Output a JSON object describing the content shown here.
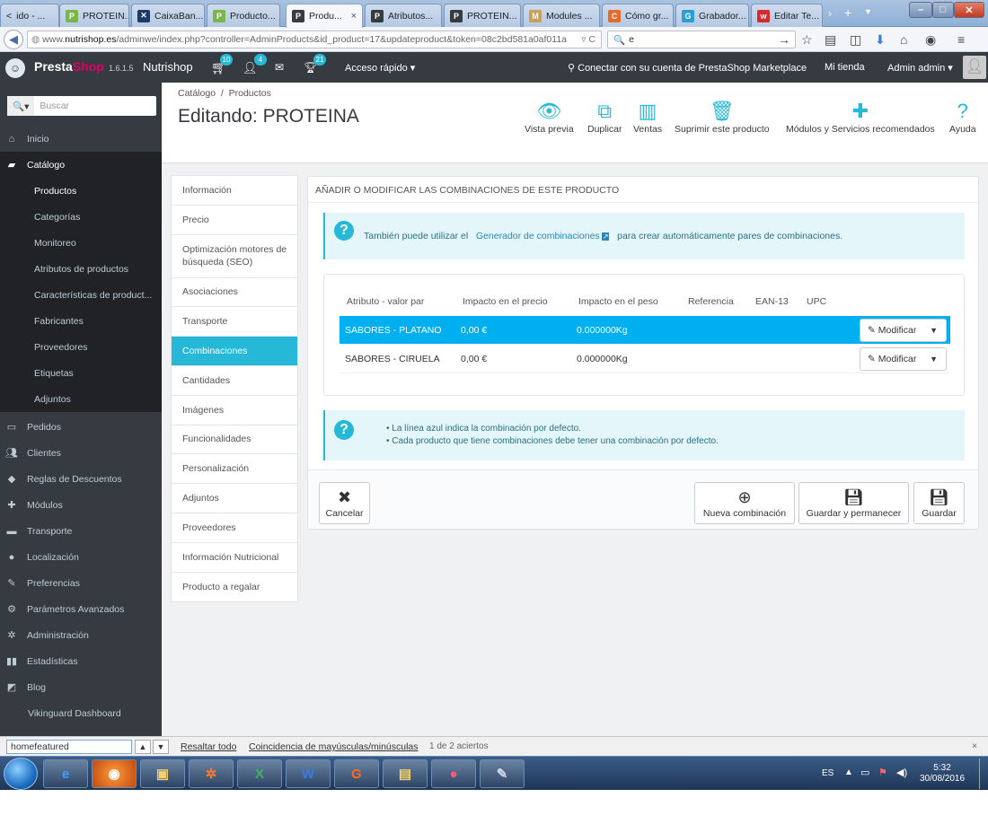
{
  "browser": {
    "tabs": [
      {
        "label": "ido - ..."
      },
      {
        "label": "PROTEIN..."
      },
      {
        "label": "CaixaBan..."
      },
      {
        "label": "Producto..."
      },
      {
        "label": "Produ..."
      },
      {
        "label": "Atributos..."
      },
      {
        "label": "PROTEIN..."
      },
      {
        "label": "Modules ..."
      },
      {
        "label": "Cómo gr..."
      },
      {
        "label": "Grabador..."
      },
      {
        "label": "Editar Te..."
      }
    ],
    "url_prefix": "www.",
    "url_domain": "nutrishop.es",
    "url_path": "/adminwe/index.php?controller=AdminProducts&id_product=17&updateproduct&token=08c2bd581a0af011a",
    "search_value": "e"
  },
  "header": {
    "brand_a": "Presta",
    "brand_b": "Shop",
    "version": "1.6.1.5",
    "shop_name": "Nutrishop",
    "badges": [
      "10",
      "4",
      "21"
    ],
    "quick_access": "Acceso rápido",
    "marketplace": "Conectar con su cuenta de PrestaShop Marketplace",
    "my_shop": "Mi tienda",
    "user": "Admin admin"
  },
  "sidebar": {
    "search_placeholder": "Buscar",
    "items": [
      "Inicio",
      "Catálogo",
      "Pedidos",
      "Clientes",
      "Reglas de Descuentos",
      "Módulos",
      "Transporte",
      "Localización",
      "Preferencias",
      "Parámetros Avanzados",
      "Administración",
      "Estadísticas",
      "Blog",
      "Vikinguard Dashboard"
    ],
    "catalog_sub": [
      "Productos",
      "Categorías",
      "Monitoreo",
      "Atributos de productos",
      "Características de product...",
      "Fabricantes",
      "Proveedores",
      "Etiquetas",
      "Adjuntos"
    ]
  },
  "page": {
    "breadcrumb": [
      "Catálogo",
      "Productos"
    ],
    "title": "Editando: PROTEINA",
    "toolbar": [
      "Vista previa",
      "Duplicar",
      "Ventas",
      "Suprimir este producto",
      "Módulos y Servicios recomendados",
      "Ayuda"
    ]
  },
  "product_tabs": [
    "Información",
    "Precio",
    "Optimización motores de búsqueda (SEO)",
    "Asociaciones",
    "Transporte",
    "Combinaciones",
    "Cantidades",
    "Imágenes",
    "Funcionalidades",
    "Personalización",
    "Adjuntos",
    "Proveedores",
    "Información Nutricional",
    "Producto a regalar"
  ],
  "panel": {
    "title": "Añadir o modificar las combinaciones de este producto",
    "info_text_a": "También puede utilizar el",
    "info_link": "Generador de combinaciones",
    "info_text_b": "para crear automáticamente pares de combinaciones.",
    "notes": [
      "La línea azul indica la combinación por defecto.",
      "Cada producto que tiene combinaciones debe tener una combinación por defecto."
    ],
    "buttons": [
      "Cancelar",
      "Nueva combinación",
      "Guardar y permanecer",
      "Guardar"
    ]
  },
  "table": {
    "columns": [
      "Atributo - valor par",
      "Impacto en el precio",
      "Impacto en el peso",
      "Referencia",
      "EAN-13",
      "UPC"
    ],
    "rows": [
      {
        "attr": "SABORES - PLATANO",
        "price": "0,00 €",
        "weight": "0.000000Kg",
        "default": true
      },
      {
        "attr": "SABORES - CIRUELA",
        "price": "0,00 €",
        "weight": "0.000000Kg",
        "default": false
      }
    ],
    "modify_label": "Modificar"
  },
  "findbar": {
    "value": "homefeatured",
    "highlight": "Resaltar todo",
    "match_case": "Coincidencia de mayúsculas/minúsculas",
    "result": "1 de 2 aciertos"
  },
  "taskbar": {
    "language": "ES",
    "time": "5:32",
    "date": "30/08/2016"
  },
  "colors": {
    "accent": "#25b9d7",
    "selected_row": "#00aff0",
    "sidebar_bg": "#363a41",
    "brand_pink": "#df0067"
  }
}
